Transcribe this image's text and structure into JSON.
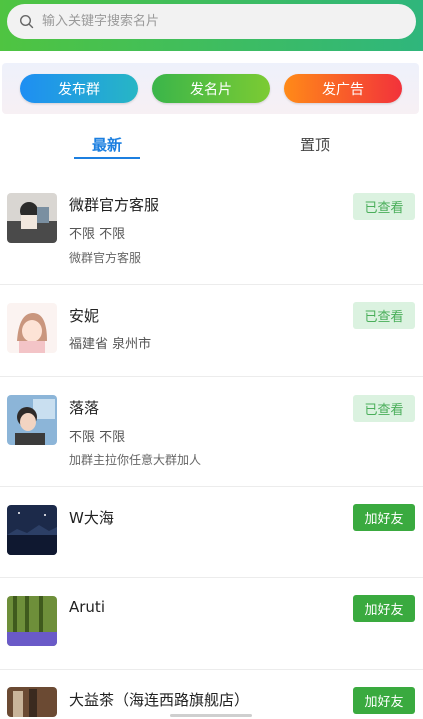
{
  "search": {
    "placeholder": "输入关键字搜索名片"
  },
  "actions": {
    "publish_group": "发布群",
    "publish_card": "发名片",
    "publish_ad": "发广告"
  },
  "tabs": {
    "latest": "最新",
    "pinned": "置顶"
  },
  "items": [
    {
      "name": "微群官方客服",
      "location": "不限 不限",
      "description": "微群官方客服",
      "status": "已查看",
      "status_type": "viewed"
    },
    {
      "name": "安妮",
      "location": "福建省 泉州市",
      "description": "",
      "status": "已查看",
      "status_type": "viewed"
    },
    {
      "name": "落落",
      "location": "不限 不限",
      "description": "加群主拉你任意大群加人",
      "status": "已查看",
      "status_type": "viewed"
    },
    {
      "name": "W大海",
      "location": "",
      "description": "",
      "status": "加好友",
      "status_type": "add"
    },
    {
      "name": "Aruti",
      "location": "",
      "description": "",
      "status": "加好友",
      "status_type": "add"
    },
    {
      "name": "大益茶（海连西路旗舰店）",
      "location": "",
      "description": "",
      "status": "加好友",
      "status_type": "add"
    }
  ],
  "colors": {
    "accent": "#1c7fe0",
    "viewed_bg": "#dbf2e0",
    "add_bg": "#3aaa3f",
    "topbar": "#4fc441"
  }
}
